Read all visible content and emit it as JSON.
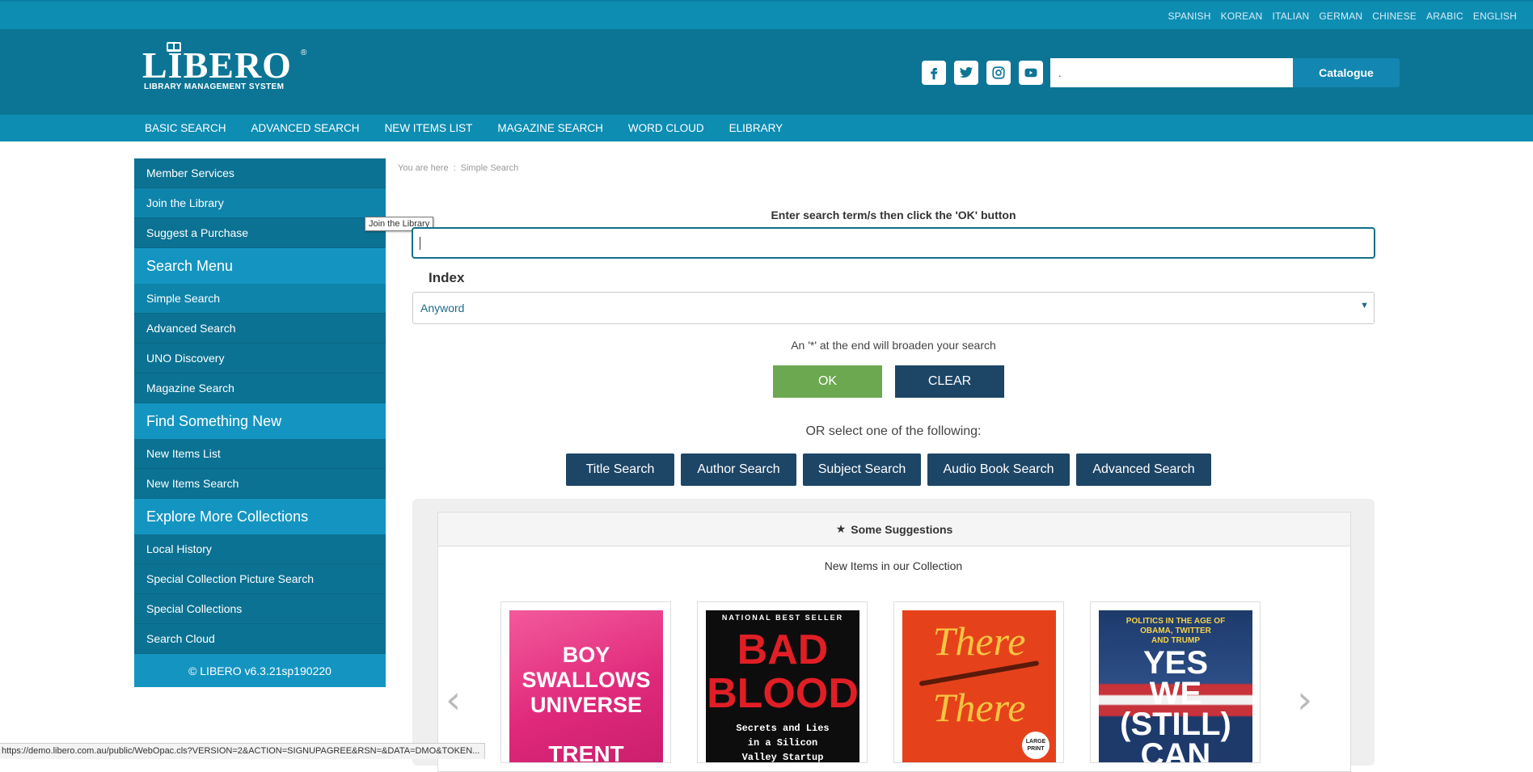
{
  "languages": [
    "SPANISH",
    "KOREAN",
    "ITALIAN",
    "GERMAN",
    "CHINESE",
    "ARABIC",
    "ENGLISH"
  ],
  "logo": {
    "word": "LIBERO",
    "sub": "LIBRARY MANAGEMENT SYSTEM",
    "reg": "®"
  },
  "header": {
    "search_value": ".",
    "catalogue_label": "Catalogue"
  },
  "social_icons": [
    "facebook-icon",
    "twitter-icon",
    "instagram-icon",
    "youtube-icon"
  ],
  "nav": [
    "BASIC SEARCH",
    "ADVANCED SEARCH",
    "NEW ITEMS LIST",
    "MAGAZINE SEARCH",
    "WORD CLOUD",
    "ELIBRARY"
  ],
  "sidebar": {
    "items": [
      {
        "type": "item",
        "label": "Member Services"
      },
      {
        "type": "item",
        "label": "Join the Library",
        "alt": true
      },
      {
        "type": "item",
        "label": "Suggest a Purchase"
      },
      {
        "type": "head",
        "label": "Search Menu"
      },
      {
        "type": "item",
        "label": "Simple Search",
        "alt": true
      },
      {
        "type": "item",
        "label": "Advanced Search"
      },
      {
        "type": "item",
        "label": "UNO Discovery"
      },
      {
        "type": "item",
        "label": "Magazine Search"
      },
      {
        "type": "head",
        "label": "Find Something New"
      },
      {
        "type": "item",
        "label": "New Items List"
      },
      {
        "type": "item",
        "label": "New Items Search"
      },
      {
        "type": "head",
        "label": "Explore More Collections"
      },
      {
        "type": "item",
        "label": "Local History"
      },
      {
        "type": "item",
        "label": "Special Collection Picture Search"
      },
      {
        "type": "item",
        "label": "Special Collections"
      },
      {
        "type": "item",
        "label": "Search Cloud"
      }
    ],
    "footer": "© LIBERO v6.3.21sp190220"
  },
  "tooltip": "Join the Library",
  "breadcrumb": {
    "prefix": "You are here",
    "sep": ":",
    "current": "Simple Search"
  },
  "search": {
    "prompt": "Enter search term/s then click the 'OK' button",
    "value": "",
    "index_label": "Index",
    "index_value": "Anyword",
    "hint": "An '*' at the end will broaden your search",
    "ok_label": "OK",
    "clear_label": "CLEAR",
    "or_text": "OR select one of the following:",
    "quick_buttons": [
      "Title Search",
      "Author Search",
      "Subject Search",
      "Audio Book Search",
      "Advanced Search"
    ]
  },
  "suggestions": {
    "title": "Some Suggestions",
    "subtitle": "New Items in our Collection",
    "books": [
      {
        "cover_lines": [
          "BOY",
          "SWALLOWS",
          "UNIVERSE",
          "TRENT"
        ],
        "bg": "#e8317a"
      },
      {
        "cover_lines": [
          "NATIONAL BEST SELLER",
          "BAD",
          "BLOOD",
          "Secrets and Lies",
          "in a Silicon",
          "Valley Startup"
        ],
        "bg": "#0d0d0d"
      },
      {
        "cover_lines": [
          "There",
          "There",
          "LARGE PRINT"
        ],
        "bg": "#e5421b"
      },
      {
        "cover_lines": [
          "POLITICS IN THE AGE OF",
          "OBAMA, TWITTER",
          "AND TRUMP",
          "YES",
          "WE",
          "(STILL)",
          "CAN"
        ],
        "bg": "#1d3a6b"
      }
    ]
  },
  "statusbar": "https://demo.libero.com.au/public/WebOpac.cls?VERSION=2&ACTION=SIGNUPAGREE&RSN=&DATA=DMO&TOKEN...",
  "colors": {
    "brand": "#0c7595",
    "nav": "#0e8db3",
    "ok": "#6ba84f",
    "dark_btn": "#1d4566"
  }
}
